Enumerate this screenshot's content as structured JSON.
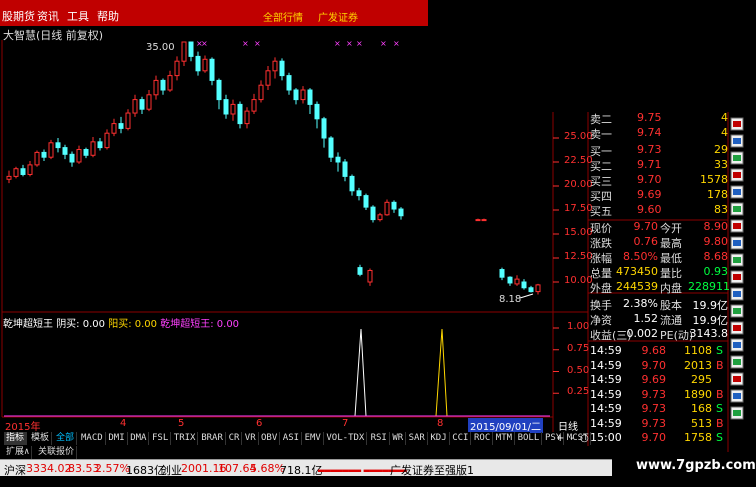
{
  "menubar": {
    "items": [
      "股期货",
      "资讯",
      "工具",
      "帮助"
    ],
    "center": [
      "全部行情",
      "广发证券"
    ]
  },
  "chart": {
    "title": "大智慧(日线 前复权)",
    "max_price_label": "35.00",
    "min_price_label": "8.18",
    "y_ticks": [
      "25.00",
      "22.50",
      "20.00",
      "17.50",
      "15.00",
      "12.50",
      "10.00"
    ],
    "ind_y_ticks": [
      "1.00",
      "0.75",
      "0.50",
      "0.25"
    ],
    "x_labels": [
      "2015年",
      "4",
      "5",
      "6",
      "7",
      "8",
      "9"
    ],
    "date_highlight": "2015/09/01/二",
    "period": "日线"
  },
  "indicator": {
    "name": "乾坤超短王",
    "yin_label": "阴买:",
    "yin_value": "0.00",
    "yang_label": "阳买:",
    "yang_value": "0.00",
    "name2": "乾坤超短王:",
    "name2_value": "0.00"
  },
  "orderbook": {
    "asks": [
      {
        "label": "卖二",
        "price": "9.75",
        "vol": "4"
      },
      {
        "label": "卖一",
        "price": "9.74",
        "vol": "4"
      }
    ],
    "bids": [
      {
        "label": "买一",
        "price": "9.73",
        "vol": "29"
      },
      {
        "label": "买二",
        "price": "9.71",
        "vol": "33"
      },
      {
        "label": "买三",
        "price": "9.70",
        "vol": "1578"
      },
      {
        "label": "买四",
        "price": "9.69",
        "vol": "178"
      },
      {
        "label": "买五",
        "price": "9.60",
        "vol": "83"
      }
    ]
  },
  "quote": {
    "rows": [
      {
        "l1": "现价",
        "v1": "9.70",
        "l2": "今开",
        "v2": "8.90"
      },
      {
        "l1": "涨跌",
        "v1": "0.76",
        "l2": "最高",
        "v2": "9.80"
      },
      {
        "l1": "涨幅",
        "v1": "8.50%",
        "l2": "最低",
        "v2": "8.68"
      },
      {
        "l1": "总量",
        "v1": "473450",
        "l2": "量比",
        "v2": "0.93"
      },
      {
        "l1": "外盘",
        "v1": "244539",
        "l2": "内盘",
        "v2": "228911"
      }
    ],
    "rows2": [
      {
        "l1": "换手",
        "v1": "2.38%",
        "l2": "股本",
        "v2": "19.9亿"
      },
      {
        "l1": "净资",
        "v1": "1.52",
        "l2": "流通",
        "v2": "19.9亿"
      },
      {
        "l1": "收益(三)",
        "v1": "0.002",
        "l2": "PE(动)",
        "v2": "3143.8"
      }
    ]
  },
  "ticks": [
    {
      "time": "14:59",
      "price": "9.68",
      "vol": "1108",
      "dir": "S"
    },
    {
      "time": "14:59",
      "price": "9.70",
      "vol": "2013",
      "dir": "B"
    },
    {
      "time": "14:59",
      "price": "9.69",
      "vol": "295",
      "dir": ""
    },
    {
      "time": "14:59",
      "price": "9.73",
      "vol": "1890",
      "dir": "B"
    },
    {
      "time": "14:59",
      "price": "9.73",
      "vol": "168",
      "dir": "S"
    },
    {
      "time": "14:59",
      "price": "9.73",
      "vol": "513",
      "dir": "B"
    },
    {
      "time": "15:00",
      "price": "9.70",
      "vol": "1758",
      "dir": "S"
    }
  ],
  "tabs": [
    "指标",
    "模板",
    "全部",
    "MACD",
    "DMI",
    "DMA",
    "FSL",
    "TRIX",
    "BRAR",
    "CR",
    "VR",
    "OBV",
    "ASI",
    "EMV",
    "VOL-TDX",
    "RSI",
    "WR",
    "SAR",
    "KDJ",
    "CCI",
    "ROC",
    "MTM",
    "BOLL",
    "PSY",
    "MCST"
  ],
  "subtabs": [
    "扩展∧",
    "关联报价"
  ],
  "right_tabs": [
    "日线",
    "+",
    "-",
    "○"
  ],
  "status": {
    "sh_label": "沪深",
    "sh_value": "3334.02",
    "sh_change": "83.53",
    "sh_pct": "2.57%",
    "sh_amount": "1683亿",
    "cy_label": "创业",
    "cy_value": "2001.16",
    "cy_change": "107.64",
    "cy_pct": "5.68%",
    "cy_amount": "718.1亿",
    "broker": "广发证券至强版1"
  },
  "watermark": "www.7gpzb.com",
  "colors": {
    "up": "#ff3030",
    "down": "#54ffff",
    "grid": "#8b0000",
    "purple": "#ff40ff"
  }
}
